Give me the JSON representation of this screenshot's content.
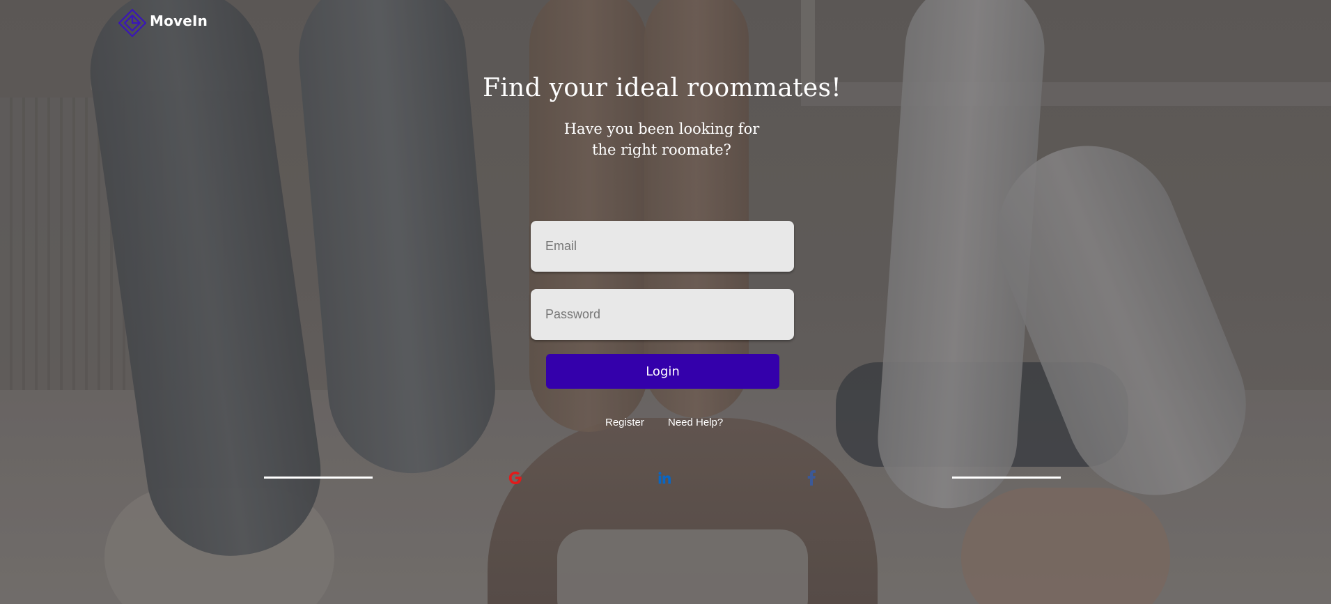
{
  "brand": {
    "name": "MoveIn",
    "accent_color": "#3400ab",
    "logo_icon": "diamond-logo-icon"
  },
  "hero": {
    "title": "Find your ideal roommates!",
    "subtitle": "Have you been looking for the right roomate?"
  },
  "form": {
    "email_placeholder": "Email",
    "email_value": "",
    "password_placeholder": "Password",
    "password_value": "",
    "login_label": "Login"
  },
  "links": {
    "register": "Register",
    "help": "Need Help?"
  },
  "social": [
    {
      "name": "google",
      "icon": "google-icon",
      "color": "#e21b1b"
    },
    {
      "name": "linkedin",
      "icon": "linkedin-icon",
      "color": "#0a66c2"
    },
    {
      "name": "facebook",
      "icon": "facebook-icon",
      "color": "#3b5998"
    }
  ]
}
